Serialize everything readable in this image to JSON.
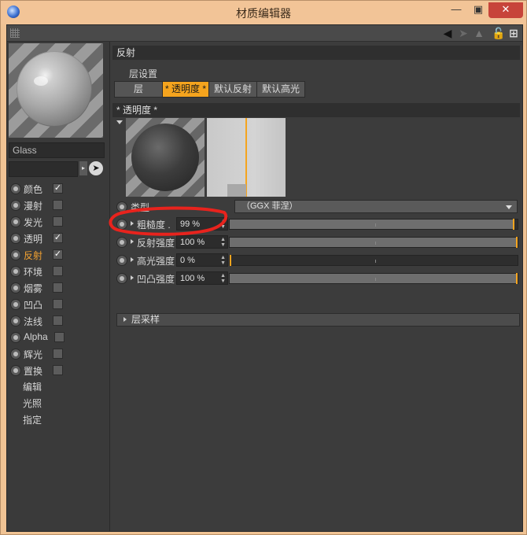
{
  "window": {
    "title": "材质编辑器"
  },
  "material": {
    "name": "Glass"
  },
  "channels": [
    {
      "label": "颜色",
      "checked": true,
      "active": false
    },
    {
      "label": "漫射",
      "checked": false,
      "active": false
    },
    {
      "label": "发光",
      "checked": false,
      "active": false
    },
    {
      "label": "透明",
      "checked": true,
      "active": false
    },
    {
      "label": "反射",
      "checked": true,
      "active": true
    },
    {
      "label": "环境",
      "checked": false,
      "active": false
    },
    {
      "label": "烟雾",
      "checked": false,
      "active": false
    },
    {
      "label": "凹凸",
      "checked": false,
      "active": false
    },
    {
      "label": "法线",
      "checked": false,
      "active": false
    },
    {
      "label": "Alpha",
      "checked": false,
      "active": false
    },
    {
      "label": "辉光",
      "checked": false,
      "active": false
    },
    {
      "label": "置换",
      "checked": false,
      "active": false
    }
  ],
  "sub_items": [
    "编辑",
    "光照",
    "指定"
  ],
  "section": {
    "title": "反射",
    "layer_settings": "层设置"
  },
  "tabs": [
    {
      "label": "层",
      "active": false
    },
    {
      "label": "* 透明度 *",
      "active": true
    },
    {
      "label": "默认反射",
      "active": false
    },
    {
      "label": "默认高光",
      "active": false
    }
  ],
  "layer": {
    "title": "* 透明度 *"
  },
  "type_row": {
    "label": "类型",
    "value": "（GGX 菲涅）"
  },
  "properties": [
    {
      "label": "粗糙度 .",
      "value": "99 %",
      "fraction": 0.99
    },
    {
      "label": "反射强度",
      "value": "100 %",
      "fraction": 1.0
    },
    {
      "label": "高光强度",
      "value": "0 %",
      "fraction": 0.0
    },
    {
      "label": "凹凸强度",
      "value": "100 %",
      "fraction": 1.0
    }
  ],
  "layer_sampling": {
    "label": "层采样"
  },
  "colors": {
    "accent": "#f5a41e",
    "annotation": "#e8231d",
    "panel": "#3c3c3c"
  }
}
